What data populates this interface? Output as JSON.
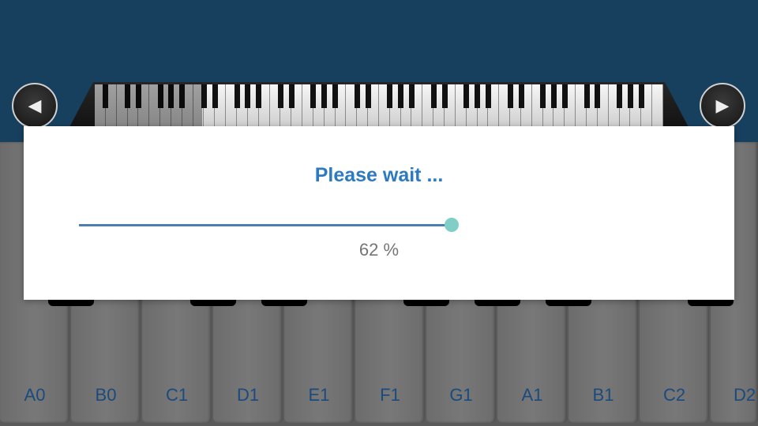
{
  "navigation": {
    "left_label": "◀",
    "right_label": "▶"
  },
  "keys": {
    "white": [
      "A0",
      "B0",
      "C1",
      "D1",
      "E1",
      "F1",
      "G1",
      "A1",
      "B1",
      "C2",
      "D2"
    ]
  },
  "dialog": {
    "title": "Please wait ...",
    "progress_percent": 62,
    "progress_text": "62 %"
  },
  "colors": {
    "header_bg": "#17405f",
    "title": "#2e7ac0",
    "slider_track": "#4a7fb0",
    "slider_thumb": "#7fcfc6",
    "key_label": "#1b4a7c"
  }
}
